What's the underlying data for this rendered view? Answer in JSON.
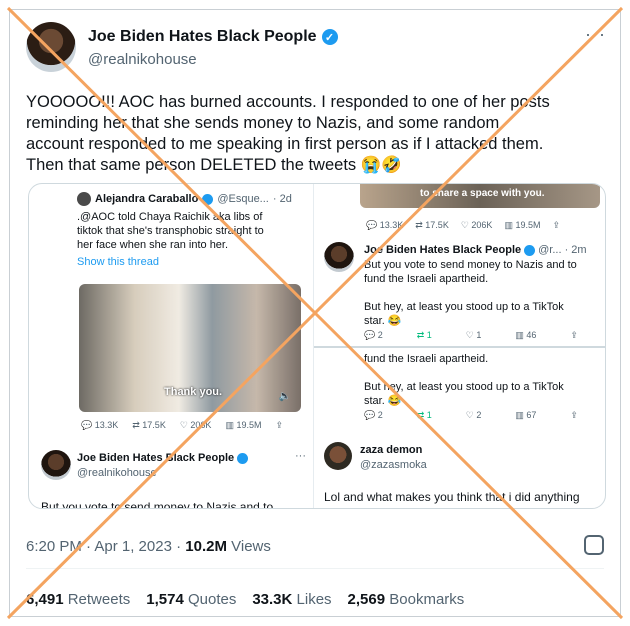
{
  "header": {
    "display_name": "Joe Biden Hates Black People",
    "handle": "@realnikohouse",
    "more": "···"
  },
  "tweet": {
    "text": "YOOOOO!!! AOC has burned accounts. I responded to one of her posts\nreminding her that she sends money to Nazis, and some random\naccount responded to me speaking in first person as if I attacked them.\nThen that same person DELETED the tweets 😭🤣"
  },
  "media": {
    "left": {
      "quote_name": "Alejandra Caraballo",
      "quote_handle": "@Esque...",
      "quote_time": "· 2d",
      "quote_text": ".@AOC told Chaya Raichik aka libs of\ntiktok that she's transphobic straight to\nher face when she ran into her.",
      "show_thread": "Show this thread",
      "video_caption": "Thank you.",
      "stats": [
        "13.3K",
        "17.5K",
        "206K",
        "19.5M"
      ],
      "reply_name": "Joe Biden Hates Black People",
      "reply_handle": "@realnikohouse",
      "reply_more": "···",
      "reply_text": "But you vote to send money to Nazis and to"
    },
    "right": {
      "top_caption": "to share a space with you.",
      "top_stats": [
        "13.3K",
        "17.5K",
        "206K",
        "19.5M"
      ],
      "reply1_name": "Joe Biden Hates Black People",
      "reply1_handle": "@r... · 2m",
      "reply1_text": "But you vote to send money to Nazis and to\nfund the Israeli apartheid.\n\nBut hey, at least you stood up to a TikTok\nstar. 😂",
      "reply1_stats": [
        "2",
        "1",
        "1",
        "46"
      ],
      "reply2_text": "fund the Israeli apartheid.\n\nBut hey, at least you stood up to a TikTok\nstar. 😂",
      "reply2_stats": [
        "2",
        "1",
        "2",
        "67"
      ],
      "zaza_name": "zaza demon",
      "zaza_handle": "@zazasmoka",
      "zaza_text": "Lol and what makes you think that i did anything"
    }
  },
  "meta": {
    "time": "6:20 PM · Apr 1, 2023 · ",
    "views_count": "10.2M",
    "views_label": " Views"
  },
  "counts": {
    "retweets": "6,491",
    "retweets_label": " Retweets",
    "quotes": "1,574",
    "quotes_label": " Quotes",
    "likes": "33.3K",
    "likes_label": " Likes",
    "bookmarks": "2,569",
    "bookmarks_label": " Bookmarks"
  },
  "colors": {
    "accent": "#1d9bf0",
    "cross": "#f4a460",
    "retweet_green": "#00ba7c"
  }
}
